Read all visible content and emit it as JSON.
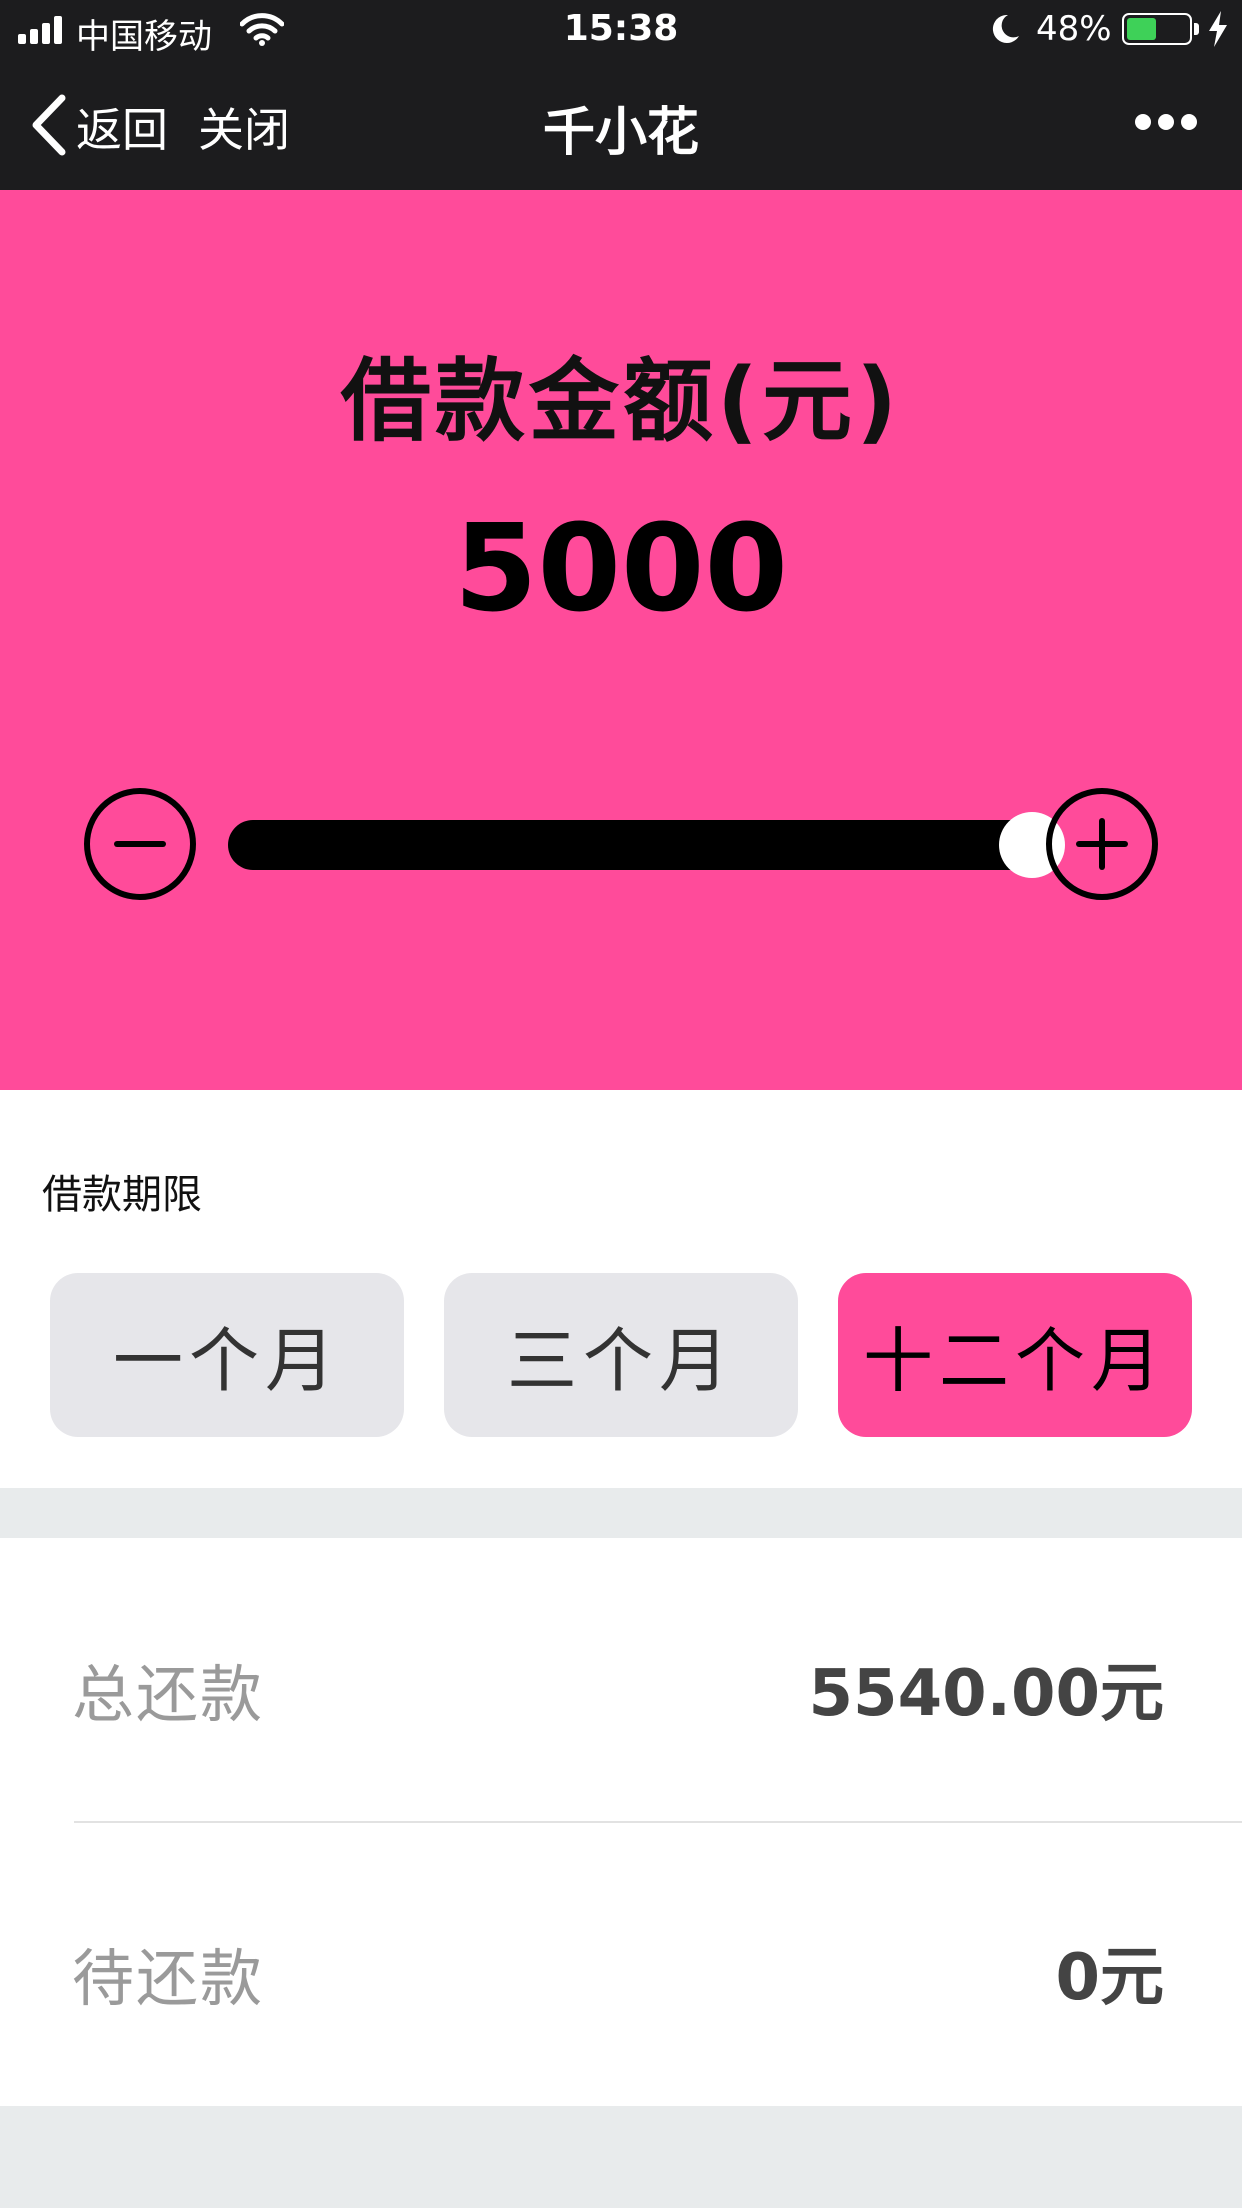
{
  "status_bar": {
    "carrier": "中国移动",
    "time": "15:38",
    "battery_percent": "48%",
    "battery_level": 0.48,
    "icons": [
      "signal-icon",
      "wifi-icon",
      "moon-icon",
      "battery-icon",
      "charging-bolt-icon"
    ]
  },
  "nav": {
    "back_label": "返回",
    "close_label": "关闭",
    "title": "千小花",
    "more_icon": "more-dots-icon"
  },
  "amount": {
    "title": "借款金额(元)",
    "value": "5000",
    "slider_fraction": 0.98,
    "minus_icon": "minus-circle-icon",
    "plus_icon": "plus-circle-icon"
  },
  "term": {
    "label": "借款期限",
    "options": [
      {
        "label": "一个月",
        "selected": false
      },
      {
        "label": "三个月",
        "selected": false
      },
      {
        "label": "十二个月",
        "selected": true
      }
    ]
  },
  "summary": {
    "rows": [
      {
        "label": "总还款",
        "value": "5540.00元"
      },
      {
        "label": "待还款",
        "value": "0元"
      }
    ]
  },
  "colors": {
    "accent": "#ff4b9a",
    "nav_bg": "#1c1c1e",
    "page_bg": "#e8ebec",
    "battery_green": "#3ed158",
    "unselected_button": "#e6e6ea"
  }
}
